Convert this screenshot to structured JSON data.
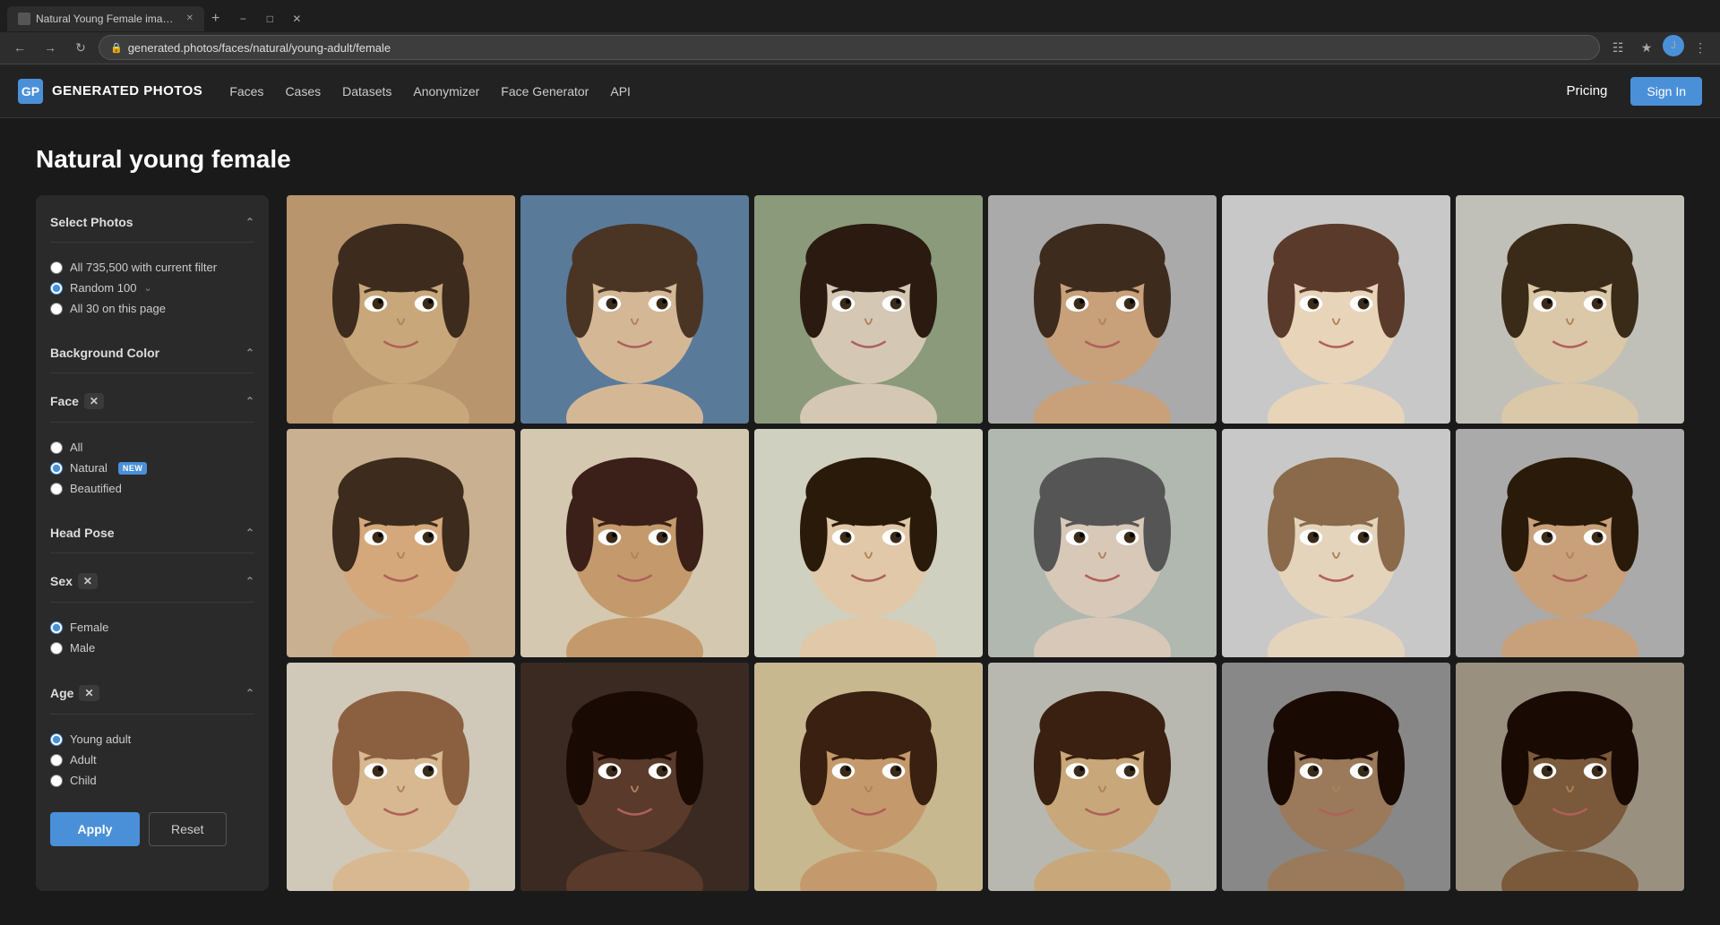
{
  "browser": {
    "tab_title": "Natural Young Female images |",
    "url": "generated.photos/faces/natural/young-adult/female",
    "favicon": "GP"
  },
  "header": {
    "logo_text": "GENERATED PHOTOS",
    "nav_links": [
      "Faces",
      "Cases",
      "Datasets",
      "Anonymizer",
      "Face Generator",
      "API"
    ],
    "pricing_label": "Pricing",
    "signin_label": "Sign In"
  },
  "page": {
    "title": "Natural young female"
  },
  "sidebar": {
    "select_photos_label": "Select Photos",
    "select_options": [
      {
        "label": "All 735,500 with current filter",
        "value": "all"
      },
      {
        "label": "Random 100",
        "value": "random100"
      },
      {
        "label": "All 30 on this page",
        "value": "page30"
      }
    ],
    "background_color_label": "Background Color",
    "face_label": "Face",
    "face_options": [
      {
        "label": "All",
        "value": "all"
      },
      {
        "label": "Natural",
        "value": "natural",
        "badge": "NEW"
      },
      {
        "label": "Beautified",
        "value": "beautified"
      }
    ],
    "head_pose_label": "Head Pose",
    "sex_label": "Sex",
    "sex_options": [
      {
        "label": "Female",
        "value": "female"
      },
      {
        "label": "Male",
        "value": "male"
      }
    ],
    "age_label": "Age",
    "age_options": [
      {
        "label": "Young adult",
        "value": "young-adult"
      },
      {
        "label": "Adult",
        "value": "adult"
      },
      {
        "label": "Child",
        "value": "child"
      }
    ],
    "apply_label": "Apply",
    "reset_label": "Reset"
  },
  "faces": {
    "colors": [
      "#c8956c",
      "#8b7355",
      "#d4a88a",
      "#c49a6c",
      "#d4b896",
      "#c8a87a",
      "#8b6e52",
      "#c49a6c",
      "#b8956c",
      "#d4c8b4",
      "#d4b896",
      "#8b6e52",
      "#c8a87a",
      "#3d2b1e",
      "#c49a6c",
      "#b8956c",
      "#8b6e52",
      "#4a3525"
    ]
  }
}
